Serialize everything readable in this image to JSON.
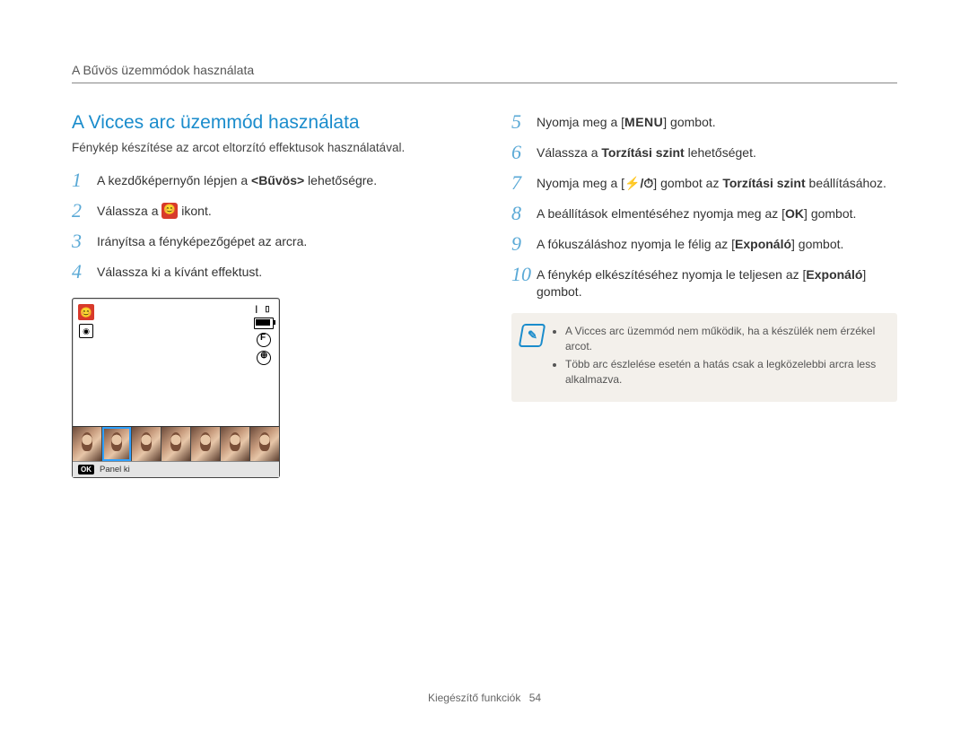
{
  "header": {
    "breadcrumb": "A Bűvös üzemmódok használata"
  },
  "left": {
    "title": "A Vicces arc üzemmód használata",
    "intro": "Fénykép készítése az arcot eltorzító effektusok használatával.",
    "steps": {
      "s1_a": "A kezdőképernyőn lépjen a ",
      "s1_b": "<Bűvös>",
      "s1_c": " lehetőségre.",
      "s2_a": "Válassza a ",
      "s2_b": " ikont.",
      "s3": "Irányítsa a fényképezőgépet az arcra.",
      "s4": "Válassza ki a kívánt effektust."
    },
    "lcd": {
      "panel_label": "Panel ki",
      "ok": "OK"
    }
  },
  "right": {
    "steps": {
      "s5_a": "Nyomja meg a [",
      "s5_menu": "MENU",
      "s5_b": "] gombot.",
      "s6_a": "Válassza a ",
      "s6_b": "Torzítási szint",
      "s6_c": " lehetőséget.",
      "s7_a": "Nyomja meg a [",
      "s7_icons": "⚡/⏱",
      "s7_b": "] gombot az ",
      "s7_c": "Torzítási szint",
      "s7_d": " beállításához.",
      "s8_a": "A beállítások elmentéséhez nyomja meg az [",
      "s8_ok": "OK",
      "s8_b": "] gombot.",
      "s9_a": "A fókuszáláshoz nyomja le félig az [",
      "s9_b": "Exponáló",
      "s9_c": "] gombot.",
      "s10_a": "A fénykép elkészítéséhez nyomja le teljesen az [",
      "s10_b": "Exponáló",
      "s10_c": "] gombot."
    },
    "note": {
      "b1": "A Vicces arc üzemmód nem működik, ha a készülék nem érzékel arcot.",
      "b2": "Több arc észlelése esetén a hatás csak a legközelebbi arcra less alkalmazva."
    }
  },
  "footer": {
    "section": "Kiegészítő funkciók",
    "page": "54"
  }
}
